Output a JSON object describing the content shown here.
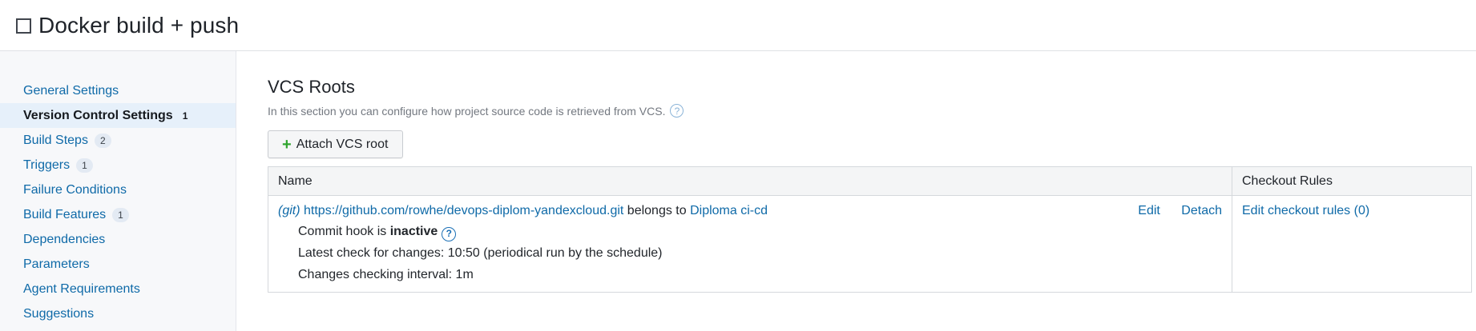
{
  "header": {
    "title": "Docker build + push"
  },
  "sidebar": {
    "items": [
      {
        "label": "General Settings",
        "count": ""
      },
      {
        "label": "Version Control Settings",
        "count": "1"
      },
      {
        "label": "Build Steps",
        "count": "2"
      },
      {
        "label": "Triggers",
        "count": "1"
      },
      {
        "label": "Failure Conditions",
        "count": ""
      },
      {
        "label": "Build Features",
        "count": "1"
      },
      {
        "label": "Dependencies",
        "count": ""
      },
      {
        "label": "Parameters",
        "count": ""
      },
      {
        "label": "Agent Requirements",
        "count": ""
      },
      {
        "label": "Suggestions",
        "count": ""
      }
    ]
  },
  "main": {
    "title": "VCS Roots",
    "description": "In this section you can configure how project source code is retrieved from VCS.",
    "attach_button": "Attach VCS root",
    "table": {
      "col_name": "Name",
      "col_rules": "Checkout Rules",
      "row": {
        "type": "(git)",
        "url": "https://github.com/rowhe/devops-diplom-yandexcloud.git",
        "belongs_to": "belongs to",
        "project": "Diploma ci-cd",
        "edit": "Edit",
        "detach": "Detach",
        "hook_prefix": "Commit hook is",
        "hook_state": "inactive",
        "latest_check": "Latest check for changes: 10:50 (periodical run by the schedule)",
        "interval": "Changes checking interval: 1m",
        "checkout_rules": "Edit checkout rules (0)"
      }
    }
  }
}
